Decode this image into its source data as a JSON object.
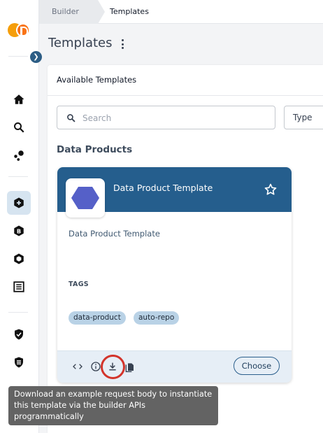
{
  "breadcrumb": {
    "items": [
      "Builder",
      "Templates"
    ]
  },
  "page": {
    "title": "Templates"
  },
  "panel": {
    "heading": "Available Templates",
    "search_placeholder": "Search",
    "type_label": "Type",
    "section_title": "Data Products"
  },
  "card": {
    "title": "Data Product Template",
    "description": "Data Product Template",
    "tags_label": "TAGS",
    "tags": [
      "data-product",
      "auto-repo"
    ],
    "choose_label": "Choose"
  },
  "tooltip": {
    "text": "Download an example request body to instantiate this template via the builder APIs programmatically"
  },
  "colors": {
    "card_header": "#255e8d",
    "accent": "#2c5d85",
    "highlight_ring": "#d3342b",
    "hexagon": "#5560c8"
  },
  "sidebar": {
    "icons": [
      "home-icon",
      "search-icon",
      "graph-icon",
      "builder-icon",
      "bitbucket-icon",
      "hexagon-icon",
      "list-icon",
      "shield-check-icon",
      "shield-list-icon"
    ]
  }
}
